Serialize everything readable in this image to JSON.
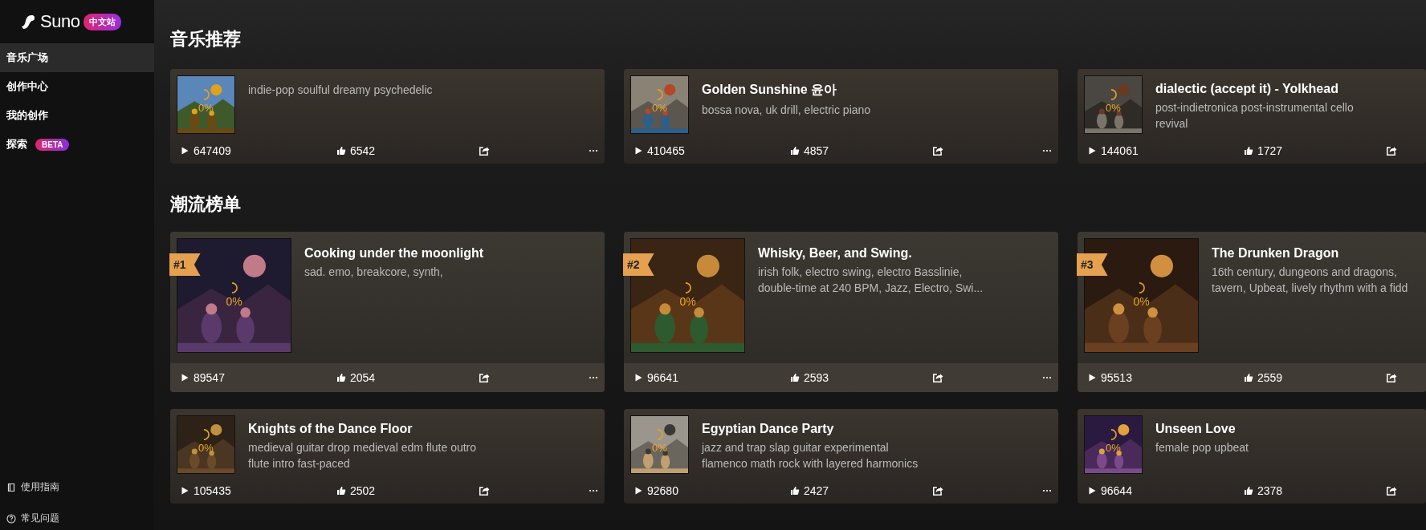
{
  "sidebar": {
    "logo": "Suno",
    "logo_badge": "中文站",
    "items": [
      {
        "label": "音乐广场",
        "selected": true
      },
      {
        "label": "创作中心",
        "selected": false
      },
      {
        "label": "我的创作",
        "selected": false
      },
      {
        "label": "探索",
        "selected": false,
        "badge": "BETA"
      }
    ],
    "footer_links": [
      {
        "label": "使用指南",
        "kind": "guide"
      },
      {
        "label": "常见问题",
        "kind": "faq"
      }
    ]
  },
  "sections": [
    {
      "title": "音乐推荐",
      "rows": [
        [
          {
            "kind": "compact",
            "description": "indie-pop soulful dreamy psychedelic",
            "progress": "0%",
            "plays": "647409",
            "likes": "6542",
            "more_button": true
          },
          {
            "kind": "compact",
            "title": "Golden Sunshine 윤아",
            "description": "bossa nova, uk drill, electric piano",
            "progress": "0%",
            "plays": "410465",
            "likes": "4857",
            "more_button": true
          },
          {
            "kind": "compact",
            "title": "dialectic (accept it) - Yolkhead",
            "description": "post-indietronica post-instrumental cello revival",
            "progress": "0%",
            "plays": "144061",
            "likes": "1727",
            "more_button": false
          }
        ]
      ]
    },
    {
      "title": "潮流榜单",
      "rows": [
        [
          {
            "kind": "featured",
            "rank": "#1",
            "title": "Cooking under the moonlight",
            "description": "sad. emo, breakcore, synth,",
            "progress": "0%",
            "plays": "89547",
            "likes": "2054",
            "more_button": true
          },
          {
            "kind": "featured",
            "rank": "#2",
            "title": "Whisky, Beer, and Swing.",
            "description": "irish folk, electro swing, electro Basslinie, double-time at 240 BPM, Jazz, Electro, Swi...",
            "progress": "0%",
            "plays": "96641",
            "likes": "2593",
            "more_button": true
          },
          {
            "kind": "featured",
            "rank": "#3",
            "title": "The Drunken Dragon",
            "description": "16th century, dungeons and dragons, tavern, Upbeat, lively rhythm with a fidd",
            "progress": "0%",
            "plays": "95513",
            "likes": "2559",
            "more_button": false
          }
        ],
        [
          {
            "kind": "compact",
            "title": "Knights of the Dance Floor",
            "description": "medieval guitar drop medieval edm flute outro flute intro fast-paced",
            "progress": "0%",
            "plays": "105435",
            "likes": "2502",
            "more_button": true
          },
          {
            "kind": "compact",
            "title": "Egyptian Dance Party",
            "description": "jazz and trap slap guitar experimental flamenco math rock with layered harmonics",
            "progress": "0%",
            "plays": "92680",
            "likes": "2427",
            "more_button": true
          },
          {
            "kind": "compact",
            "title": "Unseen Love",
            "description": "female pop upbeat",
            "progress": "0%",
            "plays": "96644",
            "likes": "2378",
            "more_button": false
          }
        ]
      ]
    }
  ]
}
